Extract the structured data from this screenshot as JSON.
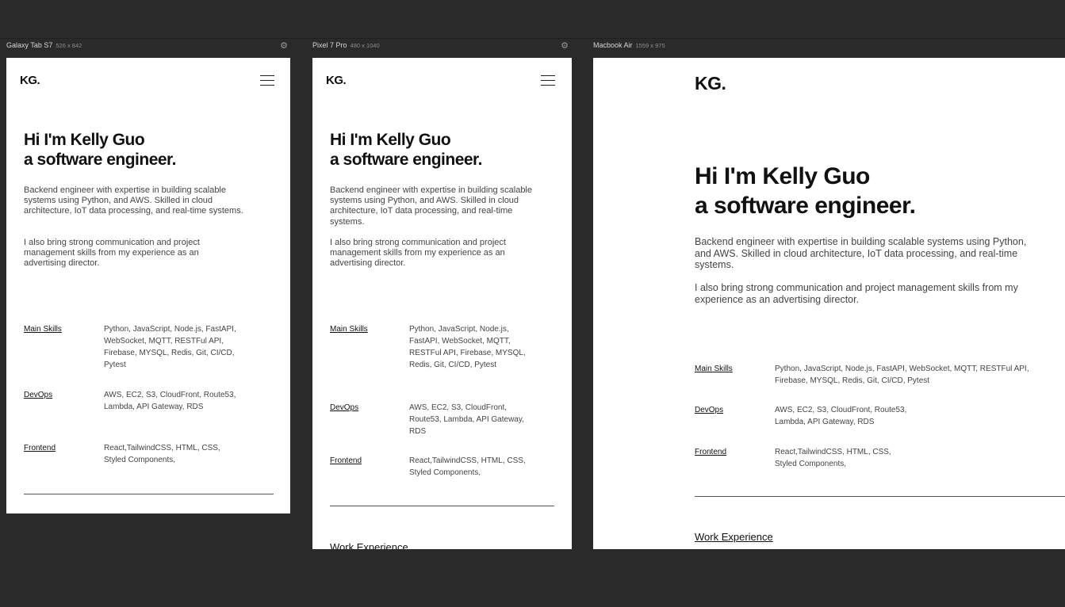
{
  "devices": [
    {
      "name": "Galaxy Tab S7",
      "size": "526 x 842"
    },
    {
      "name": "Pixel 7 Pro",
      "size": "480 x 1040"
    },
    {
      "name": "Macbook Air",
      "size": "1559 x 975"
    }
  ],
  "site": {
    "brand": "KG.",
    "hero_line1": "Hi I'm Kelly Guo",
    "hero_line2": "a software engineer.",
    "intro": "Backend engineer with expertise in building scalable systems using Python, and AWS. Skilled in cloud architecture, IoT data processing, and real-time systems.",
    "intro2": "I also bring strong communication and project management skills from my experience as an advertising director.",
    "skills": [
      {
        "label": "Main Skills",
        "value": "Python, JavaScript, Node.js, FastAPI, WebSocket, MQTT, RESTFul API, Firebase, MYSQL, Redis, Git, CI/CD, Pytest"
      },
      {
        "label": "DevOps",
        "value": "AWS, EC2, S3, CloudFront, Route53, Lambda, API Gateway, RDS"
      },
      {
        "label": "Frontend",
        "value": "React,TailwindCSS, HTML, CSS, Styled Components,"
      }
    ],
    "work_heading": "Work Experience"
  },
  "icons": {
    "gear": "gear-icon",
    "menu": "hamburger-menu-icon"
  }
}
